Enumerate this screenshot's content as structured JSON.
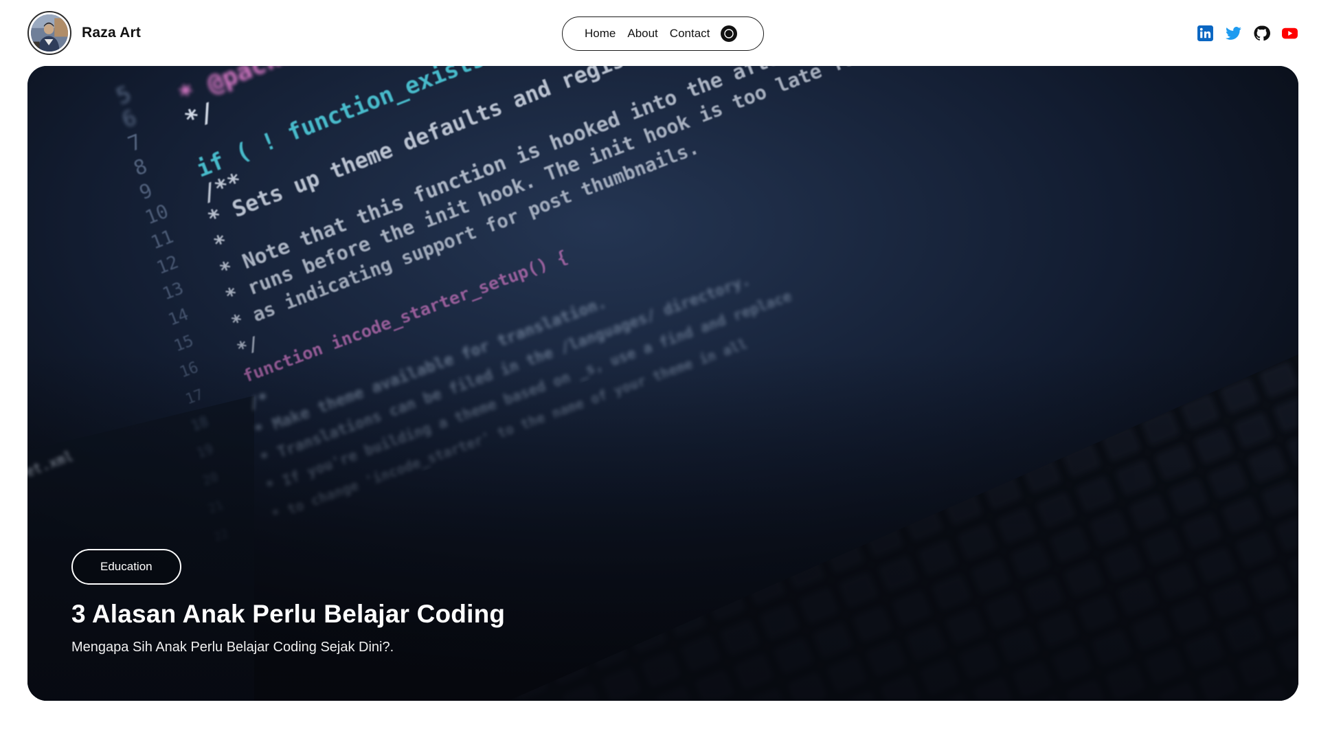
{
  "brand": {
    "name": "Raza Art",
    "avatar_icon": "user-photo-avatar"
  },
  "nav": {
    "items": [
      {
        "label": "Home"
      },
      {
        "label": "About"
      },
      {
        "label": "Contact"
      }
    ],
    "theme_toggle_icon": "moon-icon"
  },
  "socials": [
    {
      "name": "linkedin",
      "icon": "linkedin-icon",
      "color": "#0a66c2"
    },
    {
      "name": "twitter",
      "icon": "twitter-icon",
      "color": "#1d9bf0"
    },
    {
      "name": "github",
      "icon": "github-icon",
      "color": "#111111"
    },
    {
      "name": "youtube",
      "icon": "youtube-icon",
      "color": "#ff0000"
    }
  ],
  "hero": {
    "category": "Education",
    "title": "3 Alasan Anak Perlu Belajar Coding",
    "subtitle": "Mengapa Sih Anak Perlu Belajar Coding Sejak Dini?.",
    "background": "code-editor-photo",
    "code_lines": [
      {
        "num": "5",
        "text": "",
        "color": "#8fa3c0"
      },
      {
        "num": "6",
        "text": "*  @package  _s",
        "color": "#e57fd0"
      },
      {
        "num": "7",
        "text": "*/",
        "color": "#dfe6f2"
      },
      {
        "num": "8",
        "text": "",
        "color": "#8fa3c0"
      },
      {
        "num": "9",
        "text": "if ( ! function_exists( 'incode_st",
        "color": "#4fd1e0"
      },
      {
        "num": "10",
        "text": "/**",
        "color": "#dfe6f2"
      },
      {
        "num": "11",
        "text": "* Sets up theme defaults and registers support",
        "color": "#dfe6f2"
      },
      {
        "num": "12",
        "text": "*",
        "color": "#dfe6f2"
      },
      {
        "num": "13",
        "text": "* Note that this function is hooked into the after_setup_theme",
        "color": "#dfe6f2"
      },
      {
        "num": "14",
        "text": "* runs before the init hook. The init hook is too late for some",
        "color": "#dfe6f2"
      },
      {
        "num": "15",
        "text": "* as indicating support for post thumbnails.",
        "color": "#dfe6f2"
      },
      {
        "num": "16",
        "text": "*/",
        "color": "#dfe6f2"
      },
      {
        "num": "17",
        "text": "function incode_starter_setup() {",
        "color": "#e57fd0"
      },
      {
        "num": "18",
        "text": "/*",
        "color": "#9fb0c8"
      },
      {
        "num": "19",
        "text": "* Make theme available for translation.",
        "color": "#9fb0c8"
      },
      {
        "num": "20",
        "text": "* Translations can be filed in the /languages/ directory.",
        "color": "#9fb0c8"
      },
      {
        "num": "21",
        "text": "* If you're building a theme based on _s, use a find and replace",
        "color": "#9fb0c8"
      },
      {
        "num": "22",
        "text": "* to change 'incode_starter' to the name of your theme in all",
        "color": "#9fb0c8"
      }
    ]
  }
}
